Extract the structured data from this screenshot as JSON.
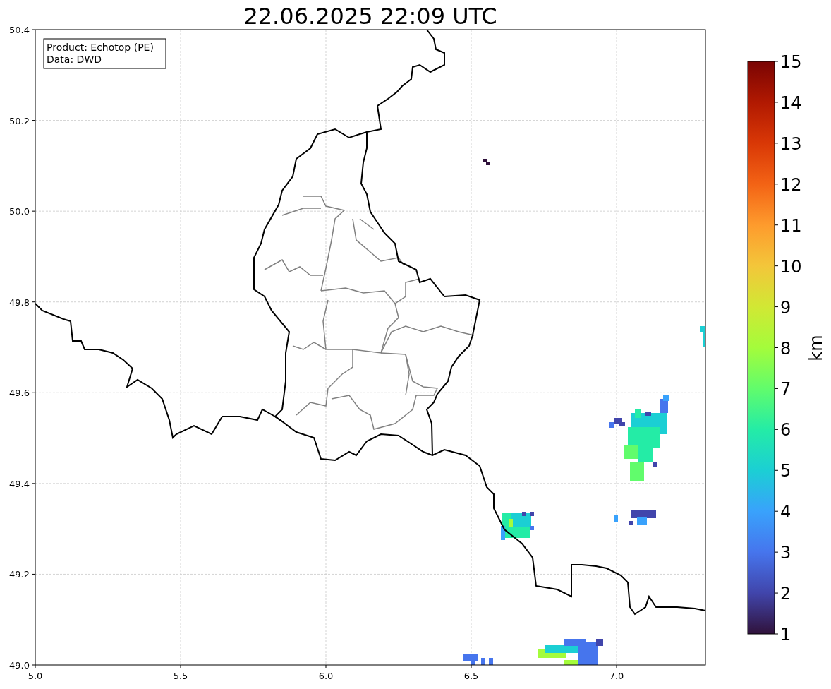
{
  "title": "22.06.2025 22:09 UTC",
  "info_box": [
    "Product: Echotop (PE)",
    "Data: DWD"
  ],
  "map": {
    "xticks": [
      "5.0",
      "5.5",
      "6.0",
      "6.5",
      "7.0"
    ],
    "yticks": [
      "50.4",
      "50.2",
      "50.0",
      "49.8",
      "49.6",
      "49.4",
      "49.2",
      "49.0"
    ]
  },
  "colorbar": {
    "label": "km",
    "ticks": [
      "15",
      "14",
      "13",
      "12",
      "11",
      "10",
      "9",
      "8",
      "7",
      "6",
      "5",
      "4",
      "3",
      "2",
      "1"
    ]
  }
}
